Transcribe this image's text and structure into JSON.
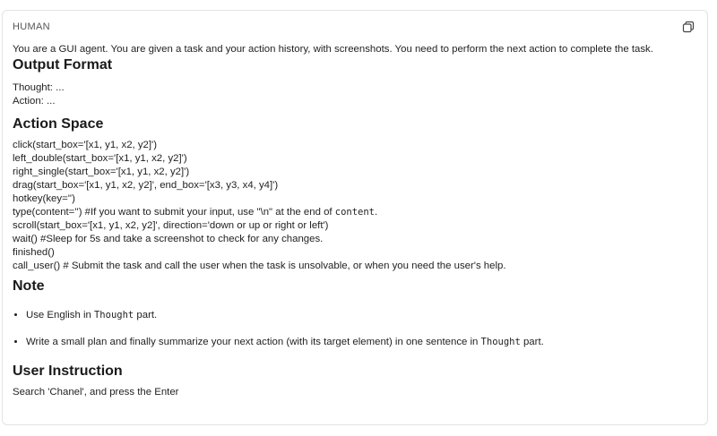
{
  "message": {
    "role": "HUMAN",
    "copy_icon": "copy-icon",
    "intro": "You are a GUI agent. You are given a task and your action history, with screenshots. You need to perform the next action to complete the task.",
    "output_format": {
      "heading": "Output Format",
      "lines": [
        "Thought: ...",
        "Action: ..."
      ]
    },
    "action_space": {
      "heading": "Action Space",
      "lines": [
        "click(start_box='[x1, y1, x2, y2]')",
        "left_double(start_box='[x1, y1, x2, y2]')",
        "right_single(start_box='[x1, y1, x2, y2]')",
        "drag(start_box='[x1, y1, x2, y2]', end_box='[x3, y3, x4, y4]')",
        "hotkey(key='')"
      ],
      "type_line": {
        "before": "type(content='') #If you want to submit your input, use \"\\n\" at the end of ",
        "code": "content",
        "after": "."
      },
      "lines_after": [
        "scroll(start_box='[x1, y1, x2, y2]', direction='down or up or right or left')",
        "wait() #Sleep for 5s and take a screenshot to check for any changes.",
        "finished()",
        "call_user() # Submit the task and call the user when the task is unsolvable, or when you need the user's help."
      ]
    },
    "note": {
      "heading": "Note",
      "items": [
        {
          "before": "Use English in ",
          "code": "Thought",
          "after": " part."
        },
        {
          "before": "Write a small plan and finally summarize your next action (with its target element) in one sentence in ",
          "code": "Thought",
          "after": " part."
        }
      ]
    },
    "user_instruction": {
      "heading": "User Instruction",
      "text": "Search 'Chanel', and press the Enter"
    }
  }
}
